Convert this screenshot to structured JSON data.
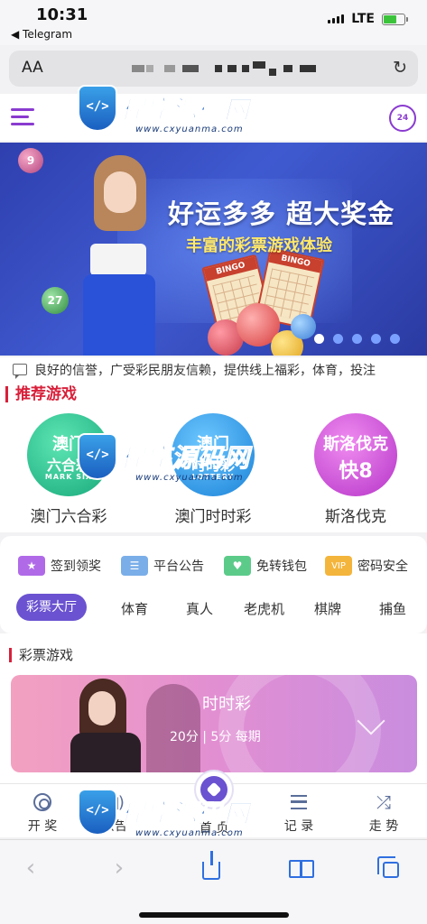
{
  "status": {
    "time": "10:31",
    "back_app": "◀ Telegram",
    "network": "LTE",
    "battery_color": "#3cc33c"
  },
  "browser": {
    "text_size_label": "AA",
    "reload_icon": "reload-icon"
  },
  "header": {
    "menu_icon": "menu-icon",
    "service_icon": "customer-service-24h-icon",
    "service_label": "24",
    "accent": "#8a3bd0"
  },
  "banner": {
    "headline": "好运多多 超大奖金",
    "subline": "丰富的彩票游戏体验",
    "ticket_label": "BINGO",
    "ball_labels": [
      "9",
      "27"
    ],
    "slide_count": 5,
    "active_slide": 1
  },
  "notice": {
    "icon": "message-icon",
    "text": "良好的信誉，广受彩民朋友信赖，提供线上福彩，体育，投注"
  },
  "recommended": {
    "title": "推荐游戏",
    "games": [
      {
        "line1": "澳门",
        "line2": "六合彩",
        "line3": "MARK SIX",
        "name": "澳门六合彩"
      },
      {
        "line1": "澳门",
        "line2": "时时彩",
        "line3": "LOTTERY",
        "name": "澳门时时彩"
      },
      {
        "line1": "斯洛伐克",
        "line2": "快8",
        "line3": "",
        "name": "斯洛伐克"
      }
    ]
  },
  "features": [
    {
      "icon": "★",
      "label": "签到领奖"
    },
    {
      "icon": "☰",
      "label": "平台公告"
    },
    {
      "icon": "♥",
      "label": "免转钱包"
    },
    {
      "icon": "VIP",
      "label": "密码安全"
    }
  ],
  "category_tabs": {
    "active": "彩票大厅",
    "others": [
      "体育",
      "真人",
      "老虎机",
      "棋牌",
      "捕鱼"
    ]
  },
  "lottery": {
    "section_title": "彩票游戏",
    "card_title": "时时彩",
    "card_sub": "20分 | 5分 每期"
  },
  "bottom_nav": [
    {
      "icon": "lottery-draw-icon",
      "label": "开 奖"
    },
    {
      "icon": "speaker-icon",
      "label": "公告"
    },
    {
      "icon": "football-icon",
      "label": "首 页"
    },
    {
      "icon": "list-icon",
      "label": "记 录"
    },
    {
      "icon": "shuffle-icon",
      "label": "走 势"
    }
  ],
  "safari": {
    "back_glyph": "‹",
    "forward_glyph": "›"
  },
  "watermark": {
    "text": "程序源码网",
    "url": "www.cxyuanma.com"
  }
}
